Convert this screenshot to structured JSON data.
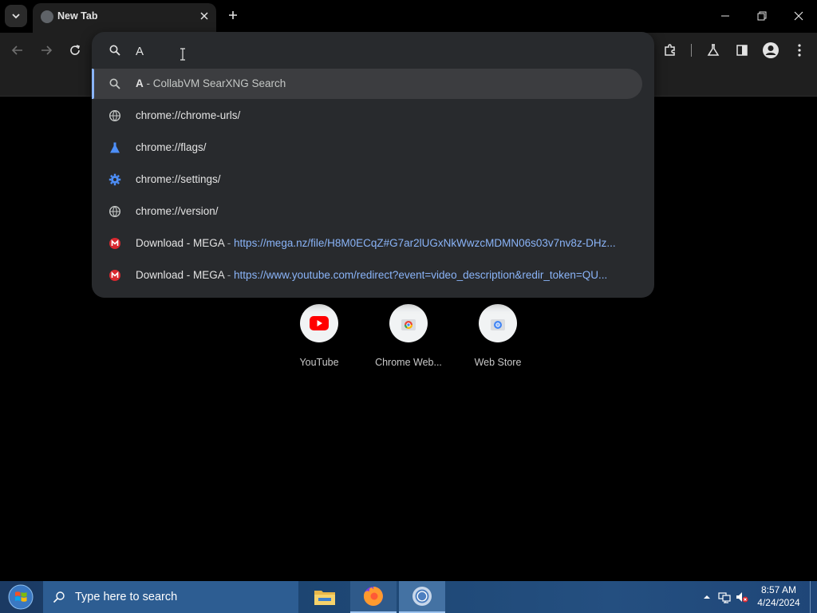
{
  "browser": {
    "tab": {
      "title": "New Tab"
    },
    "omnibox": {
      "value": "A",
      "suggestions": [
        {
          "icon": "search-icon",
          "prefix": "A",
          "text": " - CollabVM SearXNG Search"
        },
        {
          "icon": "globe-icon",
          "url": "chrome://chrome-urls/"
        },
        {
          "icon": "flask-icon",
          "url": "chrome://flags/"
        },
        {
          "icon": "gear-icon",
          "url": "chrome://settings/"
        },
        {
          "icon": "globe-icon",
          "url": "chrome://version/"
        },
        {
          "icon": "mega-icon",
          "title": "Download - MEGA",
          "sep": " - ",
          "url": "https://mega.nz/file/H8M0ECqZ#G7ar2lUGxNkWwzcMDMN06s03v7nv8z-DHz..."
        },
        {
          "icon": "mega-icon",
          "title": "Download - MEGA",
          "sep": " - ",
          "url": "https://www.youtube.com/redirect?event=video_description&redir_token=QU..."
        }
      ]
    },
    "shortcuts": [
      {
        "label": "YouTube",
        "icon": "youtube-icon"
      },
      {
        "label": "Chrome Web...",
        "icon": "chrome-icon"
      },
      {
        "label": "Web Store",
        "icon": "webstore-icon"
      }
    ]
  },
  "taskbar": {
    "search_placeholder": "Type here to search",
    "clock": {
      "time": "8:57 AM",
      "date": "4/24/2024"
    }
  },
  "colors": {
    "accent_link": "#8ab4f8",
    "omnibox_bg": "#282a2d",
    "mega_red": "#d9272e",
    "youtube_red": "#ff0000"
  }
}
